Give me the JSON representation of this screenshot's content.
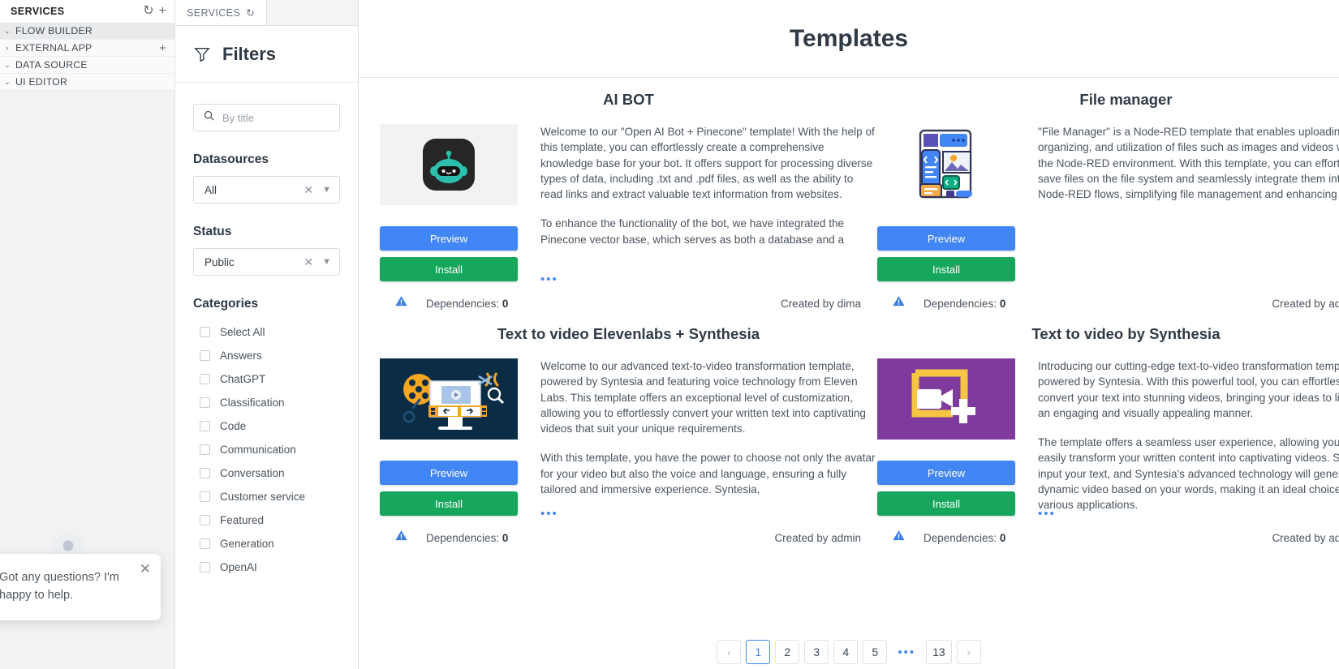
{
  "rail": {
    "header_title": "SERVICES",
    "refresh_icon": "refresh-icon",
    "add_icon": "plus-icon",
    "items": [
      {
        "label": "FLOW BUILDER",
        "caret": "⌄",
        "selected": true,
        "has_add": false
      },
      {
        "label": "EXTERNAL APP",
        "caret": "›",
        "selected": false,
        "has_add": true,
        "add_label": "+"
      },
      {
        "label": "DATA SOURCE",
        "caret": "⌄",
        "selected": false,
        "has_add": false
      },
      {
        "label": "UI EDITOR",
        "caret": "⌄",
        "selected": false,
        "has_add": false
      }
    ]
  },
  "tabbar": {
    "tab_label": "SERVICES",
    "tab_icon": "refresh-icon"
  },
  "filters": {
    "title": "Filters",
    "search": {
      "placeholder": "By title",
      "value": ""
    },
    "datasources": {
      "label": "Datasources",
      "value": "All",
      "clear": "✕",
      "chevron": "⌄"
    },
    "status": {
      "label": "Status",
      "value": "Public",
      "clear": "✕",
      "chevron": "⌄"
    },
    "categories_label": "Categories",
    "categories": [
      {
        "label": "Select All",
        "checked": false
      },
      {
        "label": "Answers",
        "checked": false
      },
      {
        "label": "ChatGPT",
        "checked": false
      },
      {
        "label": "Classification",
        "checked": false
      },
      {
        "label": "Code",
        "checked": false
      },
      {
        "label": "Communication",
        "checked": false
      },
      {
        "label": "Conversation",
        "checked": false
      },
      {
        "label": "Customer service",
        "checked": false
      },
      {
        "label": "Featured",
        "checked": false
      },
      {
        "label": "Generation",
        "checked": false
      },
      {
        "label": "OpenAI",
        "checked": false
      }
    ]
  },
  "main": {
    "title": "Templates",
    "cards": [
      {
        "title": "AI BOT",
        "thumb": "ai-bot-robot-thumbnail",
        "desc_p1": "Welcome to our \"Open AI Bot + Pinecone\" template! With the help of this template, you can effortlessly create a comprehensive knowledge base for your bot. It offers support for processing diverse types of data, including .txt and .pdf files, as well as the ability to read links and extract valuable text information from websites.",
        "desc_p2": "To enhance the functionality of the bot, we have integrated the Pinecone vector base, which serves as both a database and a",
        "more": "•••",
        "preview_label": "Preview",
        "install_label": "Install",
        "deps_label": "Dependencies:",
        "deps_count": "0",
        "created_by": "Created by dima"
      },
      {
        "title": "File manager",
        "thumb": "file-manager-thumbnail",
        "desc_p1": "\"File Manager\" is a Node-RED template that enables uploading, organizing, and utilization of files such as images and videos within the Node-RED environment. With this template, you can effortlessly save files on the file system and seamlessly integrate them into your Node-RED flows, simplifying file management and enhancing your",
        "desc_p2": "",
        "more": "",
        "preview_label": "Preview",
        "install_label": "Install",
        "deps_label": "Dependencies:",
        "deps_count": "0",
        "created_by": "Created by admin"
      },
      {
        "title": "Text to video Elevenlabs + Synthesia",
        "thumb": "video-editing-thumbnail",
        "desc_p1": "Welcome to our advanced text-to-video transformation template, powered by Syntesia and featuring voice technology from Eleven Labs. This template offers an exceptional level of customization, allowing you to effortlessly convert your written text into captivating videos that suit your unique requirements.",
        "desc_p2": "With this template, you have the power to choose not only the avatar for your video but also the voice and language, ensuring a fully tailored and immersive experience. Syntesia,",
        "more": "•••",
        "preview_label": "Preview",
        "install_label": "Install",
        "deps_label": "Dependencies:",
        "deps_count": "0",
        "created_by": "Created by admin"
      },
      {
        "title": "Text to video by Synthesia",
        "thumb": "synthesia-camera-thumbnail",
        "desc_p1": "Introducing our cutting-edge text-to-video transformation template, powered by Syntesia. With this powerful tool, you can effortlessly convert your text into stunning videos, bringing your ideas to life in an engaging and visually appealing manner.",
        "desc_p2": "The template offers a seamless user experience, allowing you to easily transform your written content into captivating videos. Simply input your text, and Syntesia's advanced technology will generate a dynamic video based on your words, making it an ideal choice for various applications.",
        "more": "•••",
        "preview_label": "Preview",
        "install_label": "Install",
        "deps_label": "Dependencies:",
        "deps_count": "0",
        "created_by": "Created by admin"
      }
    ],
    "pagination": {
      "prev": "‹",
      "next": "›",
      "dots": "•••",
      "pages": [
        "1",
        "2",
        "3",
        "4",
        "5"
      ],
      "last": "13",
      "active": "1"
    }
  },
  "chat": {
    "message": "Got any questions? I'm happy to help.",
    "close": "✕",
    "avatar": "user-avatar"
  },
  "colors": {
    "accent_blue": "#4285f4",
    "install_green": "#16a75c",
    "warning_blue": "#3b7de0"
  }
}
